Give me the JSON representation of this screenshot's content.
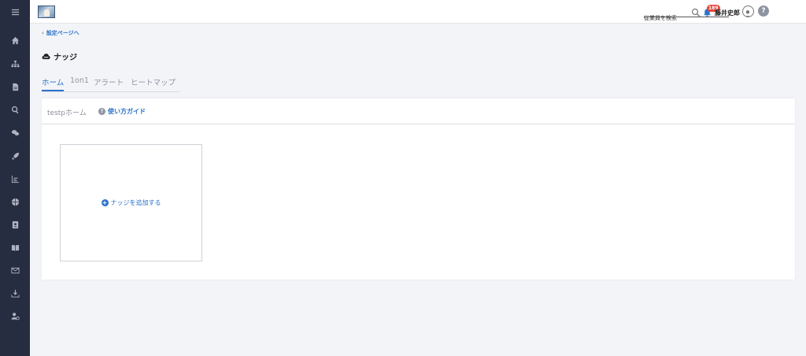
{
  "sidebar": {
    "items": [
      {
        "icon": "menu-icon"
      },
      {
        "icon": "home-icon"
      },
      {
        "icon": "org-chart-icon"
      },
      {
        "icon": "document-icon"
      },
      {
        "icon": "search-icon"
      },
      {
        "icon": "chat-icon"
      },
      {
        "icon": "rocket-icon"
      },
      {
        "icon": "chart-icon"
      },
      {
        "icon": "globe-icon"
      },
      {
        "icon": "contact-card-icon"
      },
      {
        "icon": "book-icon"
      },
      {
        "icon": "mail-icon"
      },
      {
        "icon": "download-icon"
      },
      {
        "icon": "user-settings-icon"
      }
    ]
  },
  "header": {
    "search_placeholder": "従業員を検索",
    "notification_count": "189",
    "user_name": "藤井史郎",
    "help_label": "?"
  },
  "back_link": "設定ページへ",
  "page_title": "ナッジ",
  "tabs": [
    {
      "label": "ホーム",
      "active": true
    },
    {
      "label": "1on1",
      "active": false
    },
    {
      "label": "アラート",
      "active": false
    },
    {
      "label": "ヒートマップ",
      "active": false
    }
  ],
  "card": {
    "title": "testpホーム",
    "guide_label": "使い方ガイド",
    "add_label": "ナッジを追加する"
  },
  "colors": {
    "sidebar_bg": "#262d40",
    "accent": "#2a72c9",
    "badge": "#e8473b",
    "page_bg": "#f3f4f8"
  }
}
